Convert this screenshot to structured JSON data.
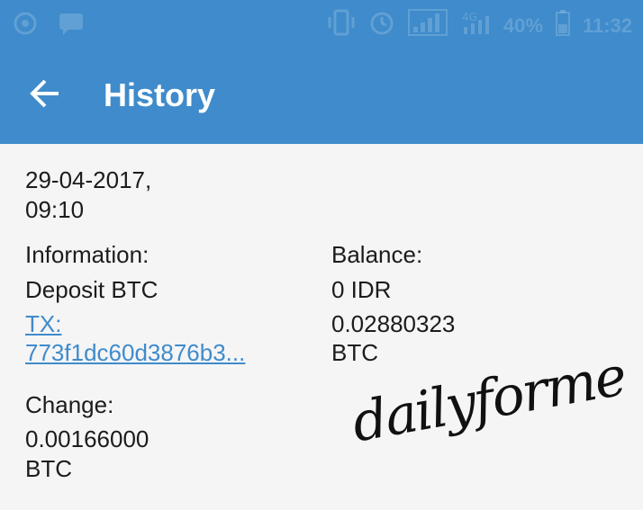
{
  "status_bar": {
    "left_icons": [
      "signal-wave-icon",
      "chat-bubble-icon"
    ],
    "right_icons": [
      "vibrate-icon",
      "alarm-icon",
      "cellular-signal-icon",
      "network-4g-icon",
      "battery-icon"
    ],
    "battery_percent": "40%",
    "time": "11:32"
  },
  "app_bar": {
    "back_icon": "arrow-left-icon",
    "title": "History",
    "color": "#3f8bcb"
  },
  "entry": {
    "date": "29-04-2017,",
    "time": "09:10",
    "information_label": "Information:",
    "information_value": "Deposit BTC",
    "tx_label": "TX:",
    "tx_hash": "773f1dc60d3876b3...",
    "balance_label": "Balance:",
    "balance_idr": "0 IDR",
    "balance_btc_amount": "0.02880323",
    "balance_btc_unit": "BTC",
    "change_label": "Change:",
    "change_amount": "0.00166000",
    "change_unit": "BTC"
  },
  "watermark": "dailyforme"
}
